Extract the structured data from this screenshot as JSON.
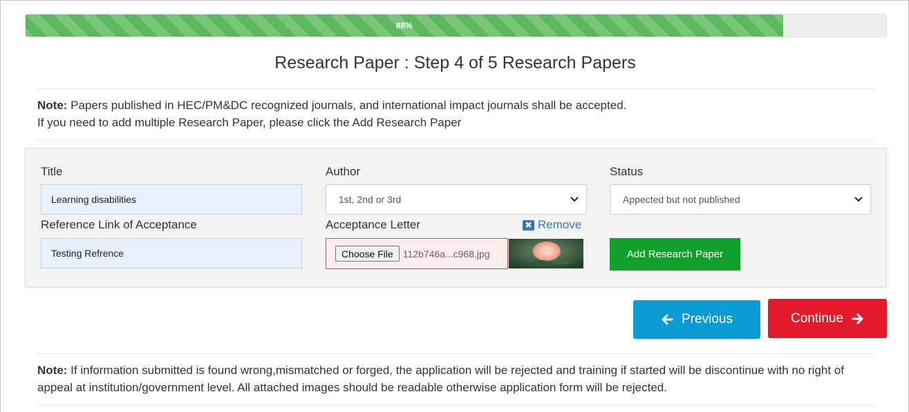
{
  "progress": {
    "value": 0.88,
    "label": "88%"
  },
  "step_title": "Research Paper : Step 4 of 5 Research Papers",
  "note_top": {
    "bold": "Note:",
    "line1": " Papers published in HEC/PM&DC recognized journals, and international impact journals shall be accepted.",
    "line2": "If you need to add multiple Research Paper, please click the Add Research Paper"
  },
  "form": {
    "title_label": "Title",
    "title_value": "Learning disabilities",
    "author_label": "Author",
    "author_value": "1st, 2nd or 3rd",
    "status_label": "Status",
    "status_value": "Appected but not published",
    "ref_label": "Reference Link of Acceptance",
    "ref_value": "Testing Refrence",
    "acceptance_label": "Acceptance Letter",
    "remove_label": "Remove",
    "choose_file_label": "Choose File",
    "file_name": "112b746a...c968.jpg",
    "add_button": "Add Research Paper"
  },
  "nav": {
    "previous": "Previous",
    "continue": "Continue"
  },
  "note_bottom": {
    "bold": "Note:",
    "text": " If information submitted is found wrong,mismatched or forged, the application will be rejected and training if started will be discontinue with no right of appeal at institution/government level. All attached images should be readable otherwise application form will be rejected."
  },
  "colors": {
    "progress": "#5cb85c",
    "add_button": "#12a02c",
    "previous_button": "#0a9bd3",
    "continue_button": "#e21a2c",
    "file_error_border": "#d34a4a"
  },
  "icons": {
    "remove": "close-square-icon",
    "previous": "arrow-left-icon",
    "continue": "arrow-right-icon",
    "select": "chevron-down-icon"
  }
}
